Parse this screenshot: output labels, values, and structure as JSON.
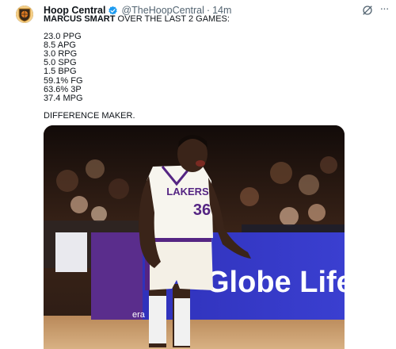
{
  "tweet": {
    "display_name": "Hoop Central",
    "handle": "@TheHoopCentral",
    "separator": "·",
    "time": "14m",
    "headline_bold": "MARCUS SMART",
    "headline_rest": " OVER THE LAST 2 GAMES:",
    "stats": [
      "23.0 PPG",
      "8.5 APG",
      "3.0 RPG",
      "5.0 SPG",
      "1.5 BPG",
      "59.1% FG",
      "63.6% 3P",
      "37.4 MPG"
    ],
    "closing": "DIFFERENCE MAKER.",
    "image": {
      "jersey_team": "LAKERS",
      "jersey_number": "36",
      "sign_text": "Globe Life",
      "sign_left_text": "era"
    }
  },
  "colors": {
    "verified_blue": "#1d9bf0",
    "lakers_purple": "#552583",
    "lakers_gold": "#fdb927",
    "muted_text": "#536471"
  },
  "icons": [
    "verified-badge-icon",
    "grok-icon",
    "more-options-icon",
    "avatar-logo-icon"
  ]
}
